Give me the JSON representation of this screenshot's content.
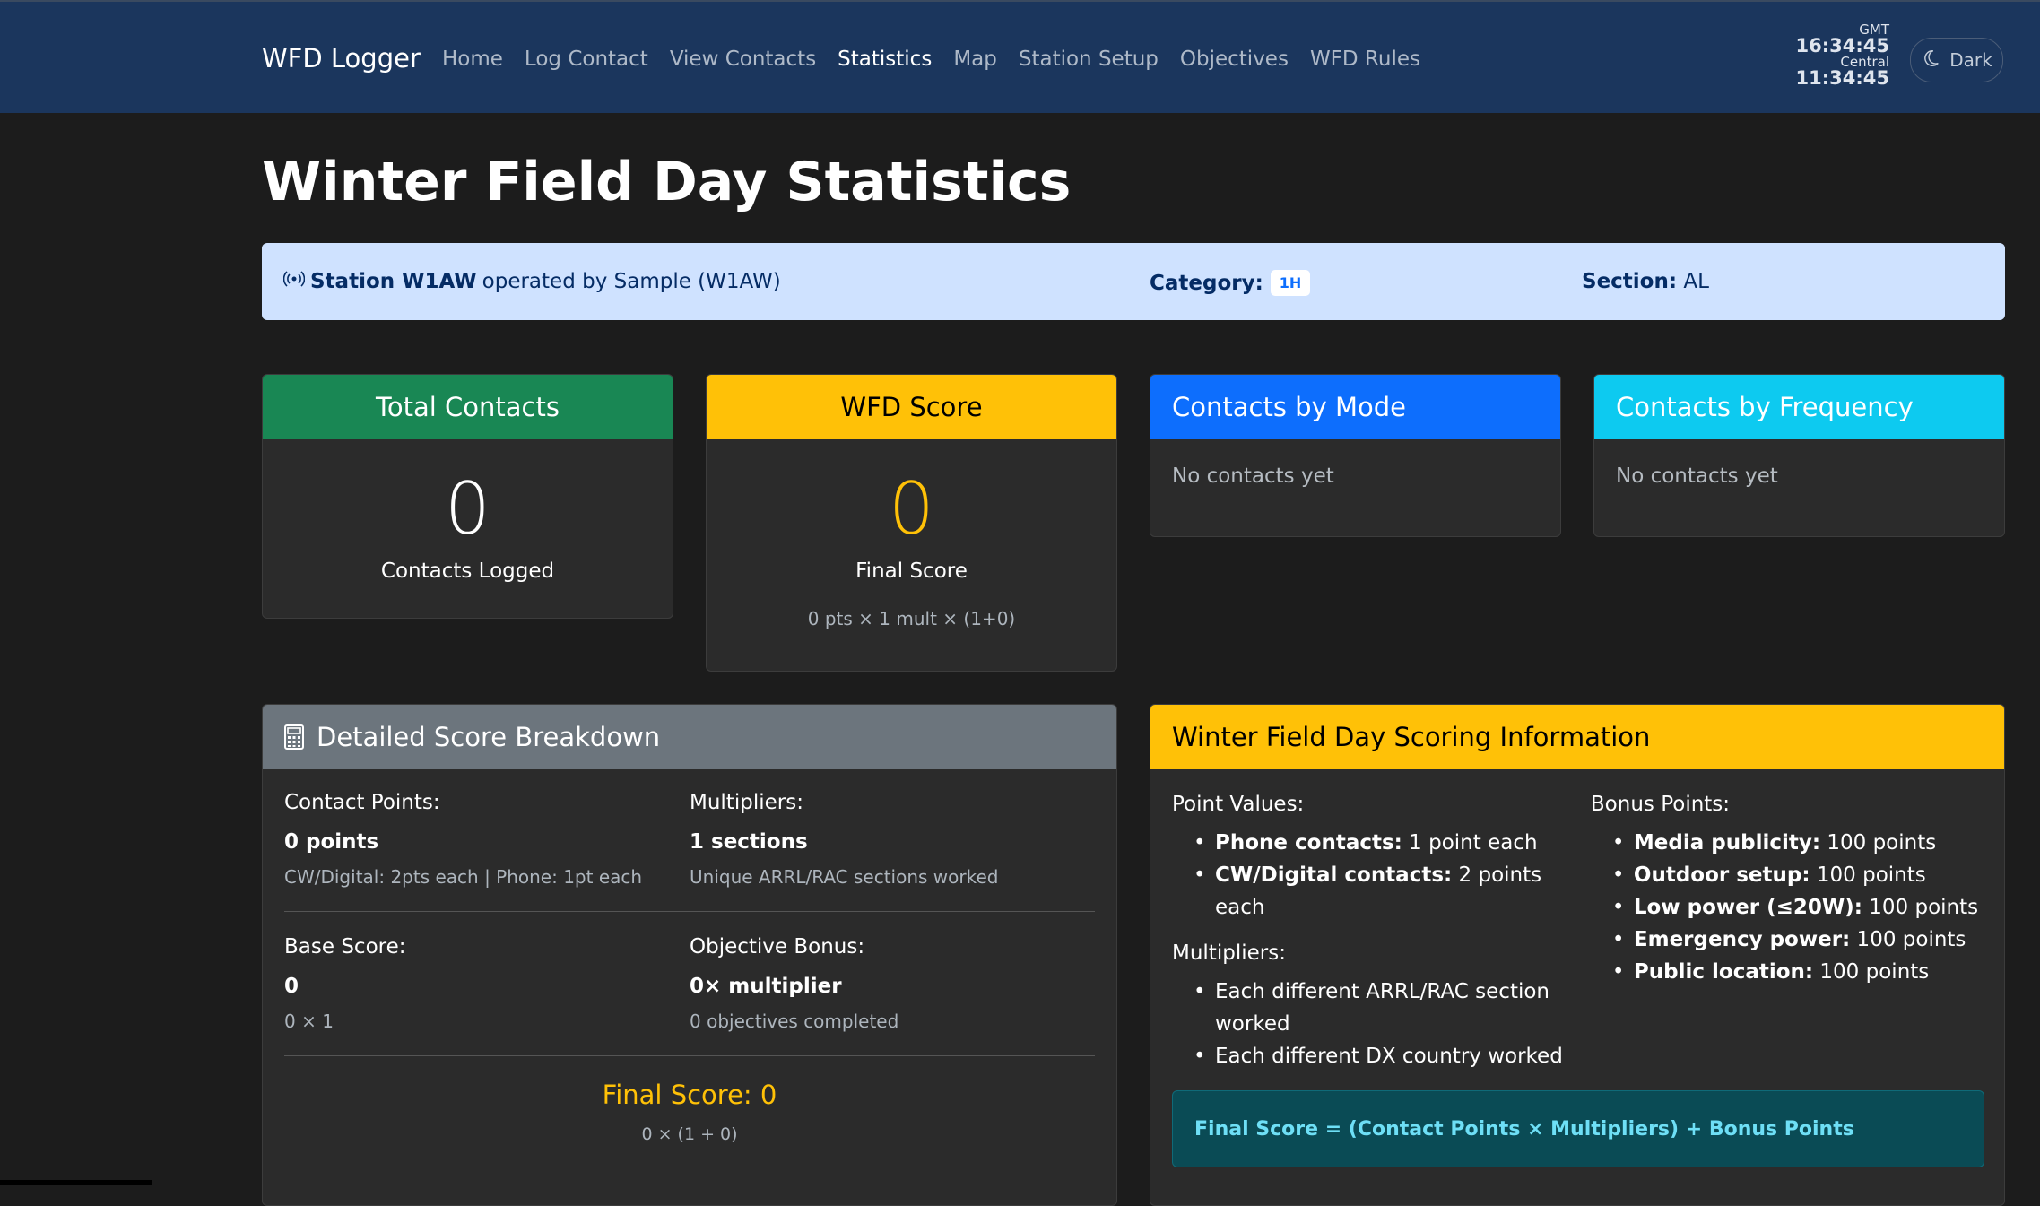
{
  "navbar": {
    "brand": "WFD Logger",
    "links": [
      "Home",
      "Log Contact",
      "View Contacts",
      "Statistics",
      "Map",
      "Station Setup",
      "Objectives",
      "WFD Rules"
    ],
    "active": "Statistics",
    "clock": {
      "tz1": "GMT",
      "time1": "16:34:45",
      "tz2": "Central",
      "time2": "11:34:45"
    },
    "theme_label": "Dark",
    "theme_icon": "moon-icon"
  },
  "page": {
    "title": "Winter Field Day Statistics"
  },
  "station_info": {
    "icon": "broadcast-icon",
    "station": "Station W1AW",
    "operated_by": "operated by Sample (W1AW)",
    "category_label": "Category:",
    "category": "1H",
    "section_label": "Section:",
    "section": "AL"
  },
  "cards": {
    "total_contacts": {
      "title": "Total Contacts",
      "value": "0",
      "sub": "Contacts Logged"
    },
    "wfd_score": {
      "title": "WFD Score",
      "value": "0",
      "sub": "Final Score",
      "formula": "0 pts × 1 mult × (1+0)"
    },
    "by_mode": {
      "title": "Contacts by Mode",
      "empty": "No contacts yet"
    },
    "by_frequency": {
      "title": "Contacts by Frequency",
      "empty": "No contacts yet"
    }
  },
  "breakdown": {
    "title": "Detailed Score Breakdown",
    "icon": "calculator-icon",
    "contact_points": {
      "label": "Contact Points:",
      "value": "0 points",
      "note": "CW/Digital: 2pts each | Phone: 1pt each"
    },
    "multipliers": {
      "label": "Multipliers:",
      "value": "1 sections",
      "note": "Unique ARRL/RAC sections worked"
    },
    "base_score": {
      "label": "Base Score:",
      "value": "0",
      "note": "0 × 1"
    },
    "objective_bonus": {
      "label": "Objective Bonus:",
      "value": "0× multiplier",
      "note": "0 objectives completed"
    },
    "final": "Final Score: 0",
    "final_formula": "0 × (1 + 0)"
  },
  "scoring_info": {
    "title": "Winter Field Day Scoring Information",
    "point_values_label": "Point Values:",
    "point_values": [
      {
        "bold": "Phone contacts:",
        "text": " 1 point each"
      },
      {
        "bold": "CW/Digital contacts:",
        "text": " 2 points each"
      }
    ],
    "multipliers_label": "Multipliers:",
    "multipliers": [
      "Each different ARRL/RAC section worked",
      "Each different DX country worked"
    ],
    "bonus_label": "Bonus Points:",
    "bonus": [
      {
        "bold": "Media publicity:",
        "text": " 100 points"
      },
      {
        "bold": "Outdoor setup:",
        "text": " 100 points"
      },
      {
        "bold": "Low power (≤20W):",
        "text": " 100 points"
      },
      {
        "bold": "Emergency power:",
        "text": " 100 points"
      },
      {
        "bold": "Public location:",
        "text": " 100 points"
      }
    ],
    "formula": "Final Score = (Contact Points × Multipliers) + Bonus Points"
  }
}
